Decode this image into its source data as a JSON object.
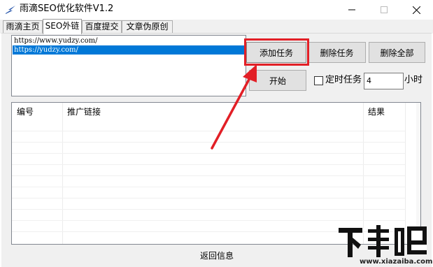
{
  "window": {
    "title": "雨滴SEO优化软件V1.2",
    "controls": {
      "minimize_icon": "minimize-icon",
      "maximize_icon": "maximize-icon",
      "close_icon": "close-icon"
    }
  },
  "tabs": [
    {
      "label": "雨滴主页",
      "active": false
    },
    {
      "label": "SEO外链",
      "active": true
    },
    {
      "label": "百度提交",
      "active": false
    },
    {
      "label": "文章伪原创",
      "active": false
    }
  ],
  "url_list": {
    "items": [
      {
        "text": "https://www.yudzy.com/",
        "selected": false
      },
      {
        "text": "https://yudzy.com/",
        "selected": true
      }
    ]
  },
  "actions": {
    "add_task": "添加任务",
    "delete_task": "删除任务",
    "delete_all": "删除全部",
    "start": "开始"
  },
  "timer": {
    "label": "定时任务",
    "checked": false,
    "interval_value": "4",
    "interval_unit": "小时"
  },
  "table": {
    "columns": [
      "编号",
      "推广链接",
      "结果"
    ],
    "rows": []
  },
  "footer": {
    "status_label": "返回信息"
  },
  "watermark": {
    "logo_text": "下载吧",
    "url": "www.xiazaiba.com"
  },
  "colors": {
    "highlight": "#e21f26",
    "selection": "#0078d7"
  }
}
